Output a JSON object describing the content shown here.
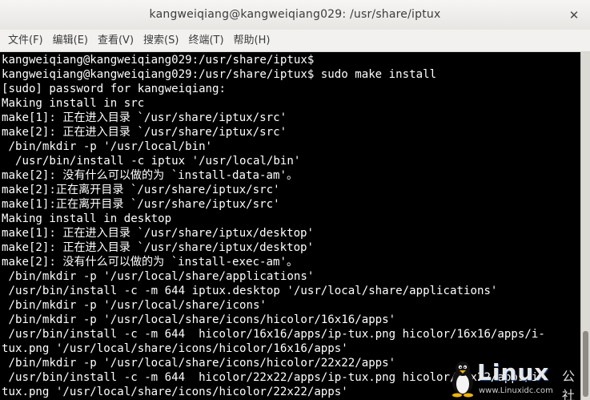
{
  "window": {
    "title": "kangweiqiang@kangweiqiang029: /usr/share/iptux"
  },
  "menubar": {
    "items": [
      {
        "label": "文件(F)"
      },
      {
        "label": "编辑(E)"
      },
      {
        "label": "查看(V)"
      },
      {
        "label": "搜索(S)"
      },
      {
        "label": "终端(T)"
      },
      {
        "label": "帮助(H)"
      }
    ]
  },
  "terminal": {
    "lines": [
      "kangweiqiang@kangweiqiang029:/usr/share/iptux$",
      "kangweiqiang@kangweiqiang029:/usr/share/iptux$ sudo make install",
      "[sudo] password for kangweiqiang:",
      "Making install in src",
      "make[1]: 正在进入目录 `/usr/share/iptux/src'",
      "make[2]: 正在进入目录 `/usr/share/iptux/src'",
      " /bin/mkdir -p '/usr/local/bin'",
      "  /usr/bin/install -c iptux '/usr/local/bin'",
      "make[2]: 没有什么可以做的为 `install-data-am'。",
      "make[2]:正在离开目录 `/usr/share/iptux/src'",
      "make[1]:正在离开目录 `/usr/share/iptux/src'",
      "Making install in desktop",
      "make[1]: 正在进入目录 `/usr/share/iptux/desktop'",
      "make[2]: 正在进入目录 `/usr/share/iptux/desktop'",
      "make[2]: 没有什么可以做的为 `install-exec-am'。",
      " /bin/mkdir -p '/usr/local/share/applications'",
      " /usr/bin/install -c -m 644 iptux.desktop '/usr/local/share/applications'",
      " /bin/mkdir -p '/usr/local/share/icons'",
      " /bin/mkdir -p '/usr/local/share/icons/hicolor/16x16/apps'",
      " /usr/bin/install -c -m 644  hicolor/16x16/apps/ip-tux.png hicolor/16x16/apps/i-",
      "tux.png '/usr/local/share/icons/hicolor/16x16/apps'",
      " /bin/mkdir -p '/usr/local/share/icons/hicolor/22x22/apps'",
      " /usr/bin/install -c -m 644  hicolor/22x22/apps/ip-tux.png hicolor/22x22/apps/i-",
      "tux.png '/usr/local/share/icons/hicolor/22x22/apps'"
    ]
  },
  "watermark": {
    "brand": "Linux",
    "brand_cn": "公社",
    "url": "www.Linuxidc.com"
  }
}
